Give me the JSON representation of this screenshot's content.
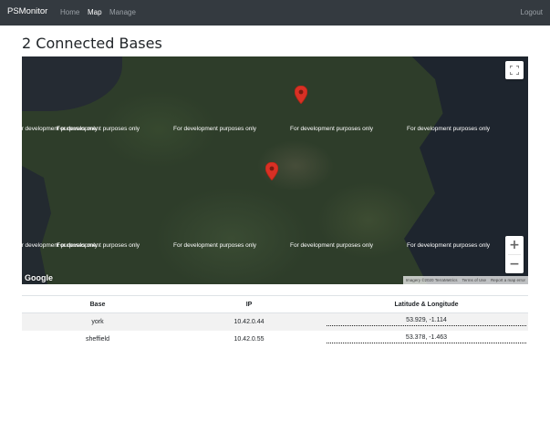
{
  "navbar": {
    "brand": "PSMonitor",
    "links": [
      {
        "label": "Home",
        "active": false
      },
      {
        "label": "Map",
        "active": true
      },
      {
        "label": "Manage",
        "active": false
      }
    ],
    "logout": "Logout"
  },
  "page": {
    "title": "2 Connected Bases"
  },
  "map": {
    "watermark": "For development purposes only",
    "google_logo": "Google",
    "attribution": [
      "Imagery ©2020 TerraMetrics",
      "Terms of Use",
      "Report a map error"
    ],
    "zoom_in": "+",
    "zoom_out": "−",
    "marker_color": "#d93025"
  },
  "table": {
    "headers": [
      "Base",
      "IP",
      "Latitude & Longitude"
    ],
    "rows": [
      {
        "base": "york",
        "ip": "10.42.0.44",
        "latlng": "53.929, -1.114"
      },
      {
        "base": "sheffield",
        "ip": "10.42.0.55",
        "latlng": "53.378, -1.463"
      }
    ]
  }
}
